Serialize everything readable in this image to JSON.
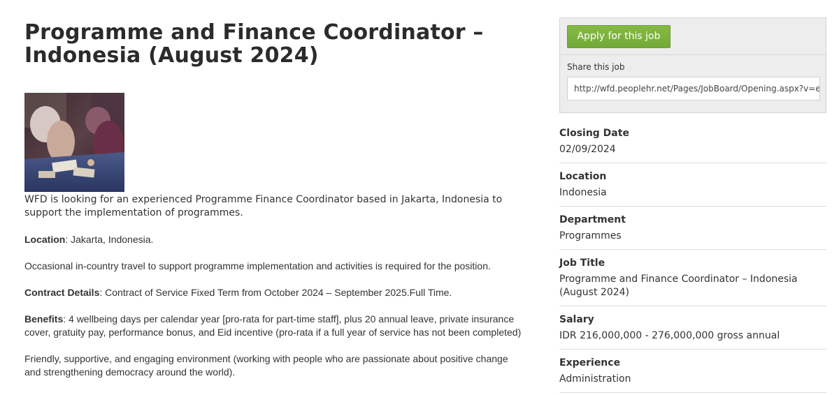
{
  "job": {
    "title": "Programme and Finance Coordinator – Indonesia (August 2024)",
    "intro": "WFD is looking for an experienced Programme Finance Coordinator based in Jakarta, Indonesia to support the implementation of programmes.",
    "location_label": "Location",
    "location_text": ": Jakarta, Indonesia.",
    "travel_text": "Occasional in-country travel to support programme implementation and activities is required for the position.",
    "contract_label": "Contract Details",
    "contract_text": ": Contract of Service Fixed Term from October 2024 – September 2025.Full Time.",
    "benefits_label": "Benefits",
    "benefits_text": ": 4 wellbeing days per calendar year [pro-rata for part-time staff], plus 20 annual leave, private insurance cover, gratuity pay, performance bonus, and Eid incentive (pro-rata if a full year of service has not been completed)",
    "environment_text": "Friendly, supportive, and engaging environment (working with people who are passionate about positive change and strengthening democracy around the world)."
  },
  "sidebar": {
    "apply_label": "Apply for this job",
    "share_label": "Share this job",
    "share_url": "http://wfd.peoplehr.net/Pages/JobBoard/Opening.aspx?v=e",
    "details": [
      {
        "label": "Closing Date",
        "value": "02/09/2024"
      },
      {
        "label": "Location",
        "value": "Indonesia"
      },
      {
        "label": "Department",
        "value": "Programmes"
      },
      {
        "label": "Job Title",
        "value": "Programme and Finance Coordinator – Indonesia (August 2024)"
      },
      {
        "label": "Salary",
        "value": "IDR 216,000,000 - 276,000,000 gross annual"
      },
      {
        "label": "Experience",
        "value": "Administration"
      }
    ]
  },
  "colors": {
    "apply_button": "#7cb342",
    "panel_bg": "#ededed"
  }
}
